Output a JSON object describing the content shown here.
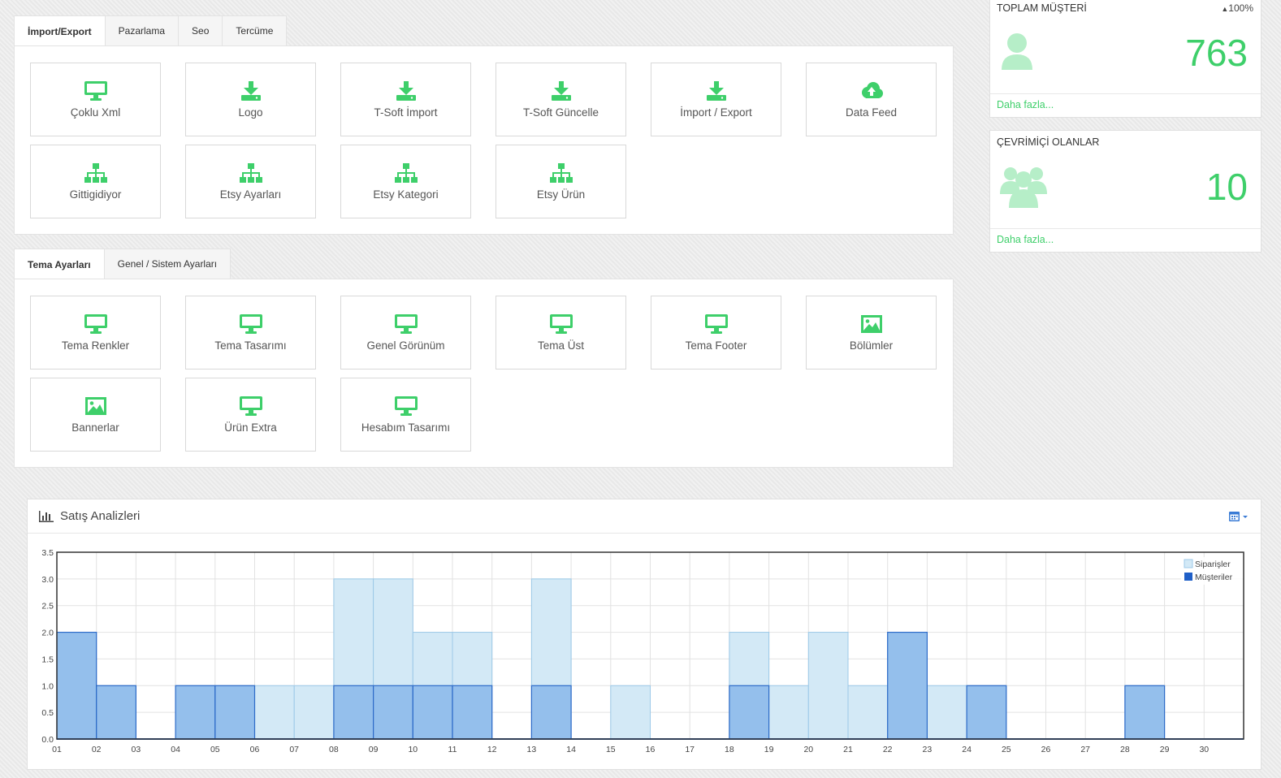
{
  "colors": {
    "accent": "#3ecf6a",
    "orders": "#d3e9f6",
    "customers": "#84b4ea"
  },
  "top_panel": {
    "tabs": [
      {
        "label": "İmport/Export",
        "active": true
      },
      {
        "label": "Pazarlama",
        "active": false
      },
      {
        "label": "Seo",
        "active": false
      },
      {
        "label": "Tercüme",
        "active": false
      }
    ],
    "tiles": [
      {
        "label": "Çoklu Xml",
        "icon": "monitor-icon"
      },
      {
        "label": "Logo",
        "icon": "download-icon"
      },
      {
        "label": "T-Soft İmport",
        "icon": "download-icon"
      },
      {
        "label": "T-Soft Güncelle",
        "icon": "download-icon"
      },
      {
        "label": "İmport / Export",
        "icon": "download-icon"
      },
      {
        "label": "Data Feed",
        "icon": "cloud-upload-icon"
      },
      {
        "label": "Gittigidiyor",
        "icon": "sitemap-icon"
      },
      {
        "label": "Etsy Ayarları",
        "icon": "sitemap-icon"
      },
      {
        "label": "Etsy Kategori",
        "icon": "sitemap-icon"
      },
      {
        "label": "Etsy Ürün",
        "icon": "sitemap-icon"
      }
    ]
  },
  "theme_panel": {
    "tabs": [
      {
        "label": "Tema Ayarları",
        "active": true
      },
      {
        "label": "Genel / Sistem Ayarları",
        "active": false
      }
    ],
    "tiles": [
      {
        "label": "Tema Renkler",
        "icon": "monitor-icon"
      },
      {
        "label": "Tema Tasarımı",
        "icon": "monitor-icon"
      },
      {
        "label": "Genel Görünüm",
        "icon": "monitor-icon"
      },
      {
        "label": "Tema Üst",
        "icon": "monitor-icon"
      },
      {
        "label": "Tema Footer",
        "icon": "monitor-icon"
      },
      {
        "label": "Bölümler",
        "icon": "image-icon"
      },
      {
        "label": "Bannerlar",
        "icon": "image-icon"
      },
      {
        "label": "Ürün Extra",
        "icon": "monitor-icon"
      },
      {
        "label": "Hesabım Tasarımı",
        "icon": "monitor-icon"
      }
    ]
  },
  "stats": {
    "customers": {
      "title": "TOPLAM MÜŞTERİ",
      "trend": "100%",
      "value": "763",
      "more": "Daha fazla...",
      "icon": "user-icon"
    },
    "online": {
      "title": "ÇEVRİMİÇİ OLANLAR",
      "value": "10",
      "more": "Daha fazla...",
      "icon": "users-icon"
    }
  },
  "sales": {
    "title": "Satış Analizleri",
    "icon": "bar-chart-icon",
    "menu_icon": "calendar-icon"
  },
  "chart_data": {
    "type": "bar",
    "title": "Satış Analizleri",
    "categories": [
      "01",
      "02",
      "03",
      "04",
      "05",
      "06",
      "07",
      "08",
      "09",
      "10",
      "11",
      "12",
      "13",
      "14",
      "15",
      "16",
      "17",
      "18",
      "19",
      "20",
      "21",
      "22",
      "23",
      "24",
      "25",
      "26",
      "27",
      "28",
      "29",
      "30"
    ],
    "ylim": [
      0,
      3.5
    ],
    "y_ticks": [
      "0.0",
      "0.5",
      "1.0",
      "1.5",
      "2.0",
      "2.5",
      "3.0",
      "3.5"
    ],
    "grid": true,
    "legend_position": "top-right",
    "series": [
      {
        "name": "Siparişler",
        "values": [
          2,
          1,
          0,
          1,
          1,
          1,
          1,
          3,
          3,
          2,
          2,
          0,
          3,
          0,
          1,
          0,
          0,
          2,
          1,
          2,
          1,
          2,
          1,
          1,
          0,
          0,
          0,
          1,
          0,
          0
        ]
      },
      {
        "name": "Müşteriler",
        "values": [
          2,
          1,
          0,
          1,
          1,
          0,
          0,
          1,
          1,
          1,
          1,
          0,
          1,
          0,
          0,
          0,
          0,
          1,
          0,
          0,
          0,
          2,
          0,
          1,
          0,
          0,
          0,
          1,
          0,
          0
        ]
      }
    ]
  }
}
